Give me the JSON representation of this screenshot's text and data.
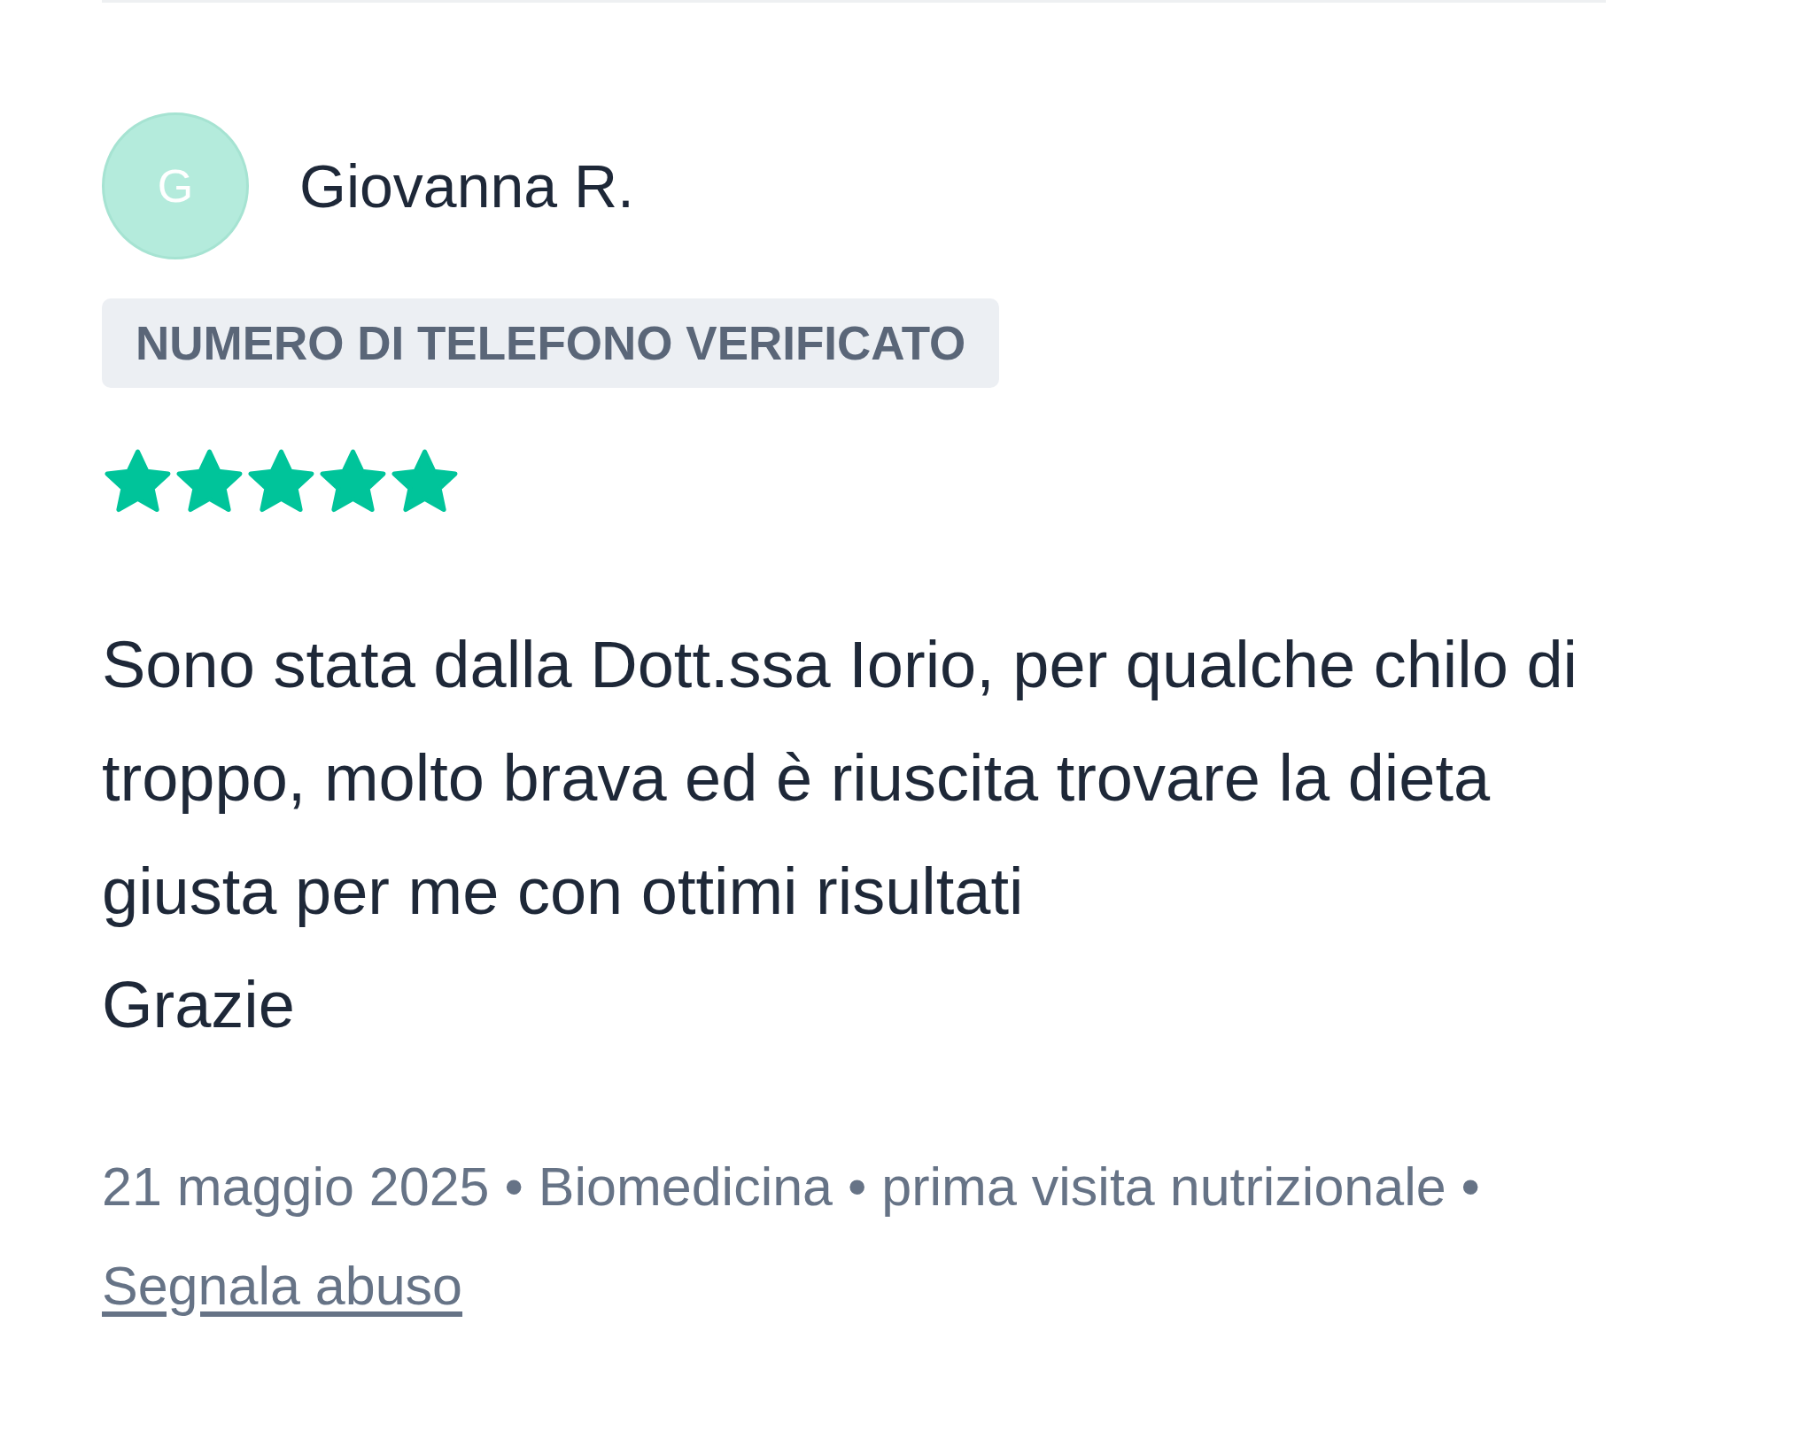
{
  "review": {
    "avatar_letter": "G",
    "author": "Giovanna R.",
    "badge": "NUMERO DI TELEFONO VERIFICATO",
    "stars": 5,
    "text": "Sono stata dalla Dott.ssa Iorio, per qualche chilo di troppo, molto brava ed è riuscita trovare la dieta giusta per me con ottimi risultati\nGrazie",
    "meta": "21 maggio 2025 • Biomedicina • prima visita nutrizionale •",
    "report_link": "Segnala abuso"
  }
}
